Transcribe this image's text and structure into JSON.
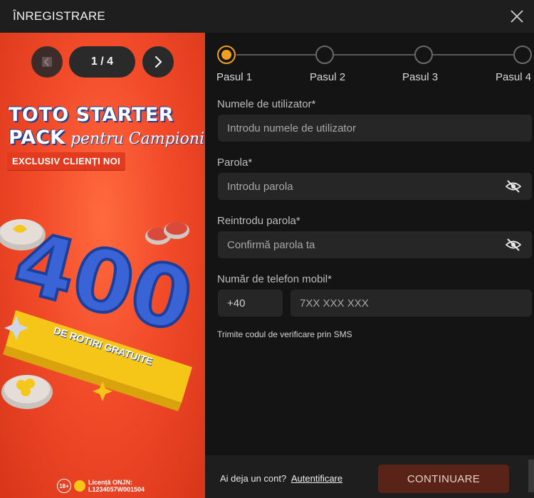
{
  "header": {
    "title": "ÎNREGISTRARE",
    "close_icon": "close-icon"
  },
  "banner": {
    "pager": {
      "counter": "1 / 4"
    },
    "headline_1": "TOTO STARTER",
    "headline_2": "PACK",
    "headline_script": "pentru Campioni",
    "badge": "EXCLUSIV CLIENȚI NOI",
    "art_number": "400",
    "art_ribbon": "DE ROTIRI GRATUITE",
    "age_badge": "18+",
    "license": "Licență ONJN: L1234057W001504",
    "colors": {
      "background": "#f24b2a",
      "accent_blue": "#1c3f9a"
    }
  },
  "stepper": {
    "steps": [
      {
        "label": "Pasul 1",
        "active": true
      },
      {
        "label": "Pasul 2",
        "active": false
      },
      {
        "label": "Pasul 3",
        "active": false
      },
      {
        "label": "Pasul 4",
        "active": false
      }
    ],
    "active_color": "#f0a020"
  },
  "form": {
    "username": {
      "label": "Numele de utilizator*",
      "placeholder": "Introdu numele de utilizator",
      "value": ""
    },
    "password": {
      "label": "Parola*",
      "placeholder": "Introdu parola",
      "value": ""
    },
    "confirm_password": {
      "label": "Reintrodu parola*",
      "placeholder": "Confirmă parola ta",
      "value": ""
    },
    "phone": {
      "label": "Număr de telefon mobil*",
      "prefix": "+40",
      "placeholder": "7XX XXX XXX",
      "value": ""
    },
    "sms_hint": "Trimite codul de verificare prin SMS"
  },
  "footer": {
    "have_account": "Ai deja un cont?",
    "login_link": "Autentificare",
    "continue_label": "CONTINUARE",
    "continue_color": "#5a2318"
  }
}
